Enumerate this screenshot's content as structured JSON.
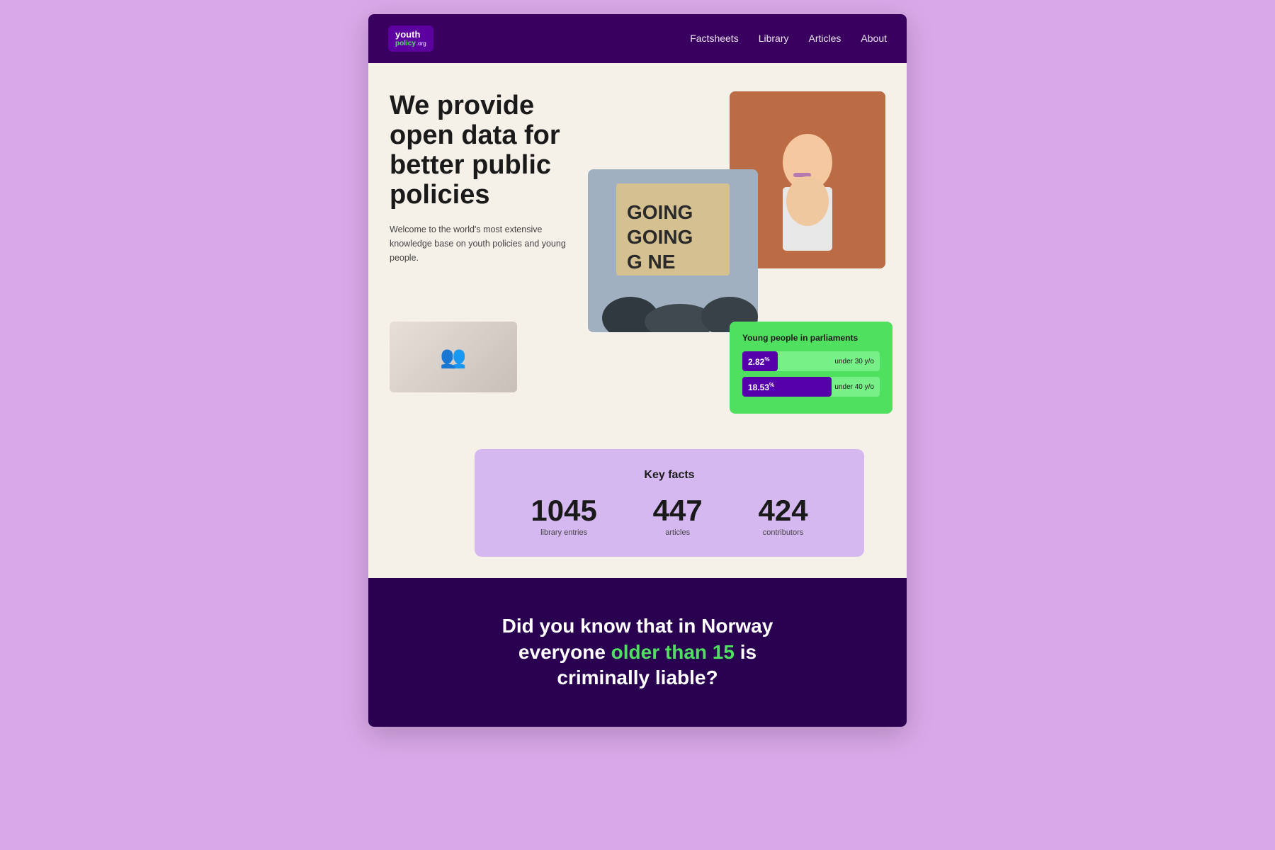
{
  "nav": {
    "logo_top": "youth",
    "logo_bottom": "policy",
    "logo_dot": ".org",
    "links": [
      {
        "label": "Factsheets",
        "href": "#"
      },
      {
        "label": "Library",
        "href": "#"
      },
      {
        "label": "Articles",
        "href": "#"
      },
      {
        "label": "About",
        "href": "#"
      }
    ]
  },
  "hero": {
    "title": "We provide open data for better public policies",
    "subtitle": "Welcome to the world's most extensive knowledge base on youth policies and young people."
  },
  "parliament_card": {
    "title": "Young people in parliaments",
    "bar1_value": "2.82",
    "bar1_unit": "%",
    "bar1_label": "under 30 y/o",
    "bar1_width": "12%",
    "bar2_value": "18.53",
    "bar2_unit": "%",
    "bar2_label": "under 40 y/o",
    "bar2_width": "60%"
  },
  "key_facts": {
    "title": "Key facts",
    "items": [
      {
        "number": "1045",
        "label": "library entries"
      },
      {
        "number": "447",
        "label": "articles"
      },
      {
        "number": "424",
        "label": "contributors"
      }
    ]
  },
  "footer": {
    "text_plain1": "Did you know that in Norway",
    "text_plain2": "everyone",
    "text_highlight": "older than 15",
    "text_plain3": "is",
    "text_plain4": "criminally liable?"
  },
  "colors": {
    "accent_green": "#50e060",
    "accent_purple": "#3a0060",
    "bg_cream": "#f5f0e8",
    "bg_lavender": "#d9a8e8",
    "stats_bg": "#50e060",
    "bar_purple": "#5500aa",
    "key_facts_bg": "#d5b8f0"
  }
}
